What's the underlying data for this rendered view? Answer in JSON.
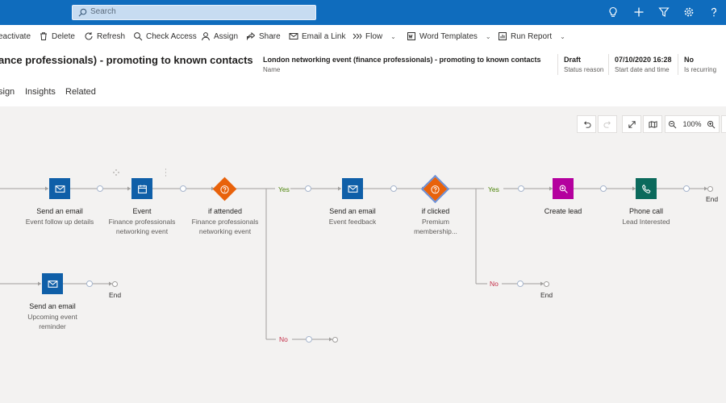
{
  "search": {
    "placeholder": "Search"
  },
  "commands": [
    {
      "label": "eactivate",
      "icon": "deactivate-icon"
    },
    {
      "label": "Delete",
      "icon": "trash-icon"
    },
    {
      "label": "Refresh",
      "icon": "refresh-icon"
    },
    {
      "label": "Check Access",
      "icon": "check-access-icon"
    },
    {
      "label": "Assign",
      "icon": "person-icon"
    },
    {
      "label": "Share",
      "icon": "share-icon"
    },
    {
      "label": "Email a Link",
      "icon": "mail-icon"
    },
    {
      "label": "Flow",
      "icon": "flow-icon"
    },
    {
      "label": "Word Templates",
      "icon": "word-icon"
    },
    {
      "label": "Run Report",
      "icon": "report-icon"
    }
  ],
  "header": {
    "title": "ance professionals) - promoting to known contacts",
    "name_value": "London networking event (finance professionals) - promoting to known contacts",
    "name_label": "Name",
    "status_value": "Draft",
    "status_label": "Status reason",
    "date_value": "07/10/2020 16:28",
    "date_label": "Start date and time",
    "recurring_value": "No",
    "recurring_label": "Is recurring"
  },
  "tabs": [
    "sign",
    "Insights",
    "Related"
  ],
  "canvas": {
    "zoom": "100%"
  },
  "colors": {
    "topbar": "#0f6cbd",
    "email": "#0f5fa8",
    "condition": "#e8620b",
    "lead": "#b4009e",
    "phone": "#0b6a5c",
    "yes": "#498205",
    "no": "#c4314b"
  },
  "nodes": {
    "email1": {
      "title": "Send an email",
      "sub": "Event follow up details"
    },
    "event": {
      "title": "Event",
      "sub": "Finance professionals networking event"
    },
    "attended": {
      "title": "if attended",
      "sub": "Finance professionals networking event"
    },
    "email2": {
      "title": "Send an email",
      "sub": "Event feedback"
    },
    "clicked": {
      "title": "if clicked",
      "sub": "Premium membership..."
    },
    "lead": {
      "title": "Create lead",
      "sub": ""
    },
    "phone": {
      "title": "Phone call",
      "sub": "Lead Interested"
    },
    "email3": {
      "title": "Send an email",
      "sub": "Upcoming event reminder"
    }
  },
  "branch": {
    "yes": "Yes",
    "no": "No",
    "end": "End"
  }
}
